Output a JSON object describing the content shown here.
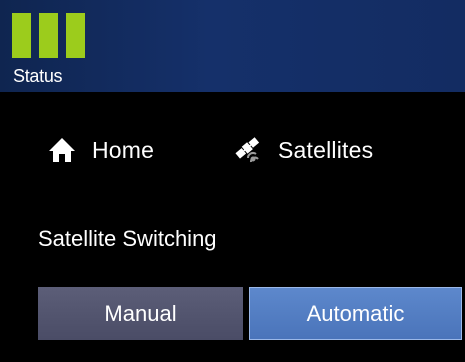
{
  "status": {
    "label": "Status",
    "bars_active": 3,
    "bar_color": "#9ccc1c",
    "banner_color": "#132c62"
  },
  "nav": {
    "items": [
      {
        "label": "Home",
        "icon": "home-icon"
      },
      {
        "label": "Satellites",
        "icon": "satellite-icon"
      }
    ]
  },
  "satellite_switching": {
    "label": "Satellite Switching",
    "options": [
      {
        "label": "Manual",
        "selected": false
      },
      {
        "label": "Automatic",
        "selected": true
      }
    ],
    "selected_color": "#4a74ba",
    "unselected_color": "#4a4c66"
  }
}
